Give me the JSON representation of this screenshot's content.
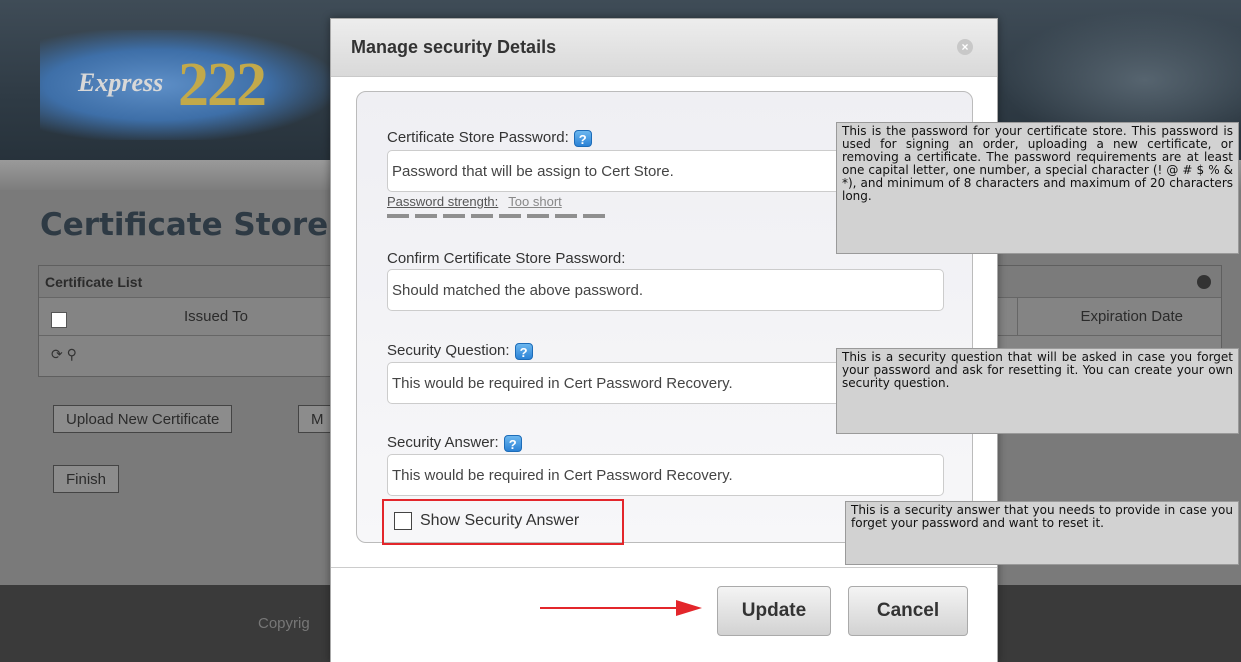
{
  "background": {
    "logo_text": "Express",
    "logo_number": "222",
    "page_title": "Certificate Store",
    "grid_caption": "Certificate List",
    "col_issued_to": "Issued To",
    "col_expiration": "Expiration Date",
    "toolbar_icons": "⟳ ⚲",
    "upload_button": "Upload New Certificate",
    "partial_button": "M",
    "finish_button": "Finish",
    "footer_text": "Copyrig"
  },
  "modal": {
    "title": "Manage security Details",
    "close_icon": "×",
    "cert_password_label": "Certificate Store Password:",
    "cert_password_placeholder": "Password that will be assign to Cert Store.",
    "strength_label": "Password strength:",
    "strength_value": "Too short",
    "confirm_label": "Confirm Certificate Store Password:",
    "confirm_placeholder": "Should matched the above password.",
    "question_label": "Security Question:",
    "question_placeholder": "This would be required in Cert Password Recovery.",
    "answer_label": "Security Answer:",
    "answer_placeholder": "This would be required in Cert Password Recovery.",
    "show_answer_label": "Show Security Answer",
    "update_button": "Update",
    "cancel_button": "Cancel",
    "help_glyph": "?"
  },
  "tooltips": {
    "password": "This is the password for your certificate store. This password is used for signing an order, uploading a new certificate, or removing a certificate. The password requirements are at least one capital letter, one number, a special character (! @ # $ % & *), and minimum of 8 characters and maximum of 20 characters long.",
    "question": "This is a security question that will be asked in case you forget your password and ask for resetting it. You can create your own security question.",
    "answer": "This is a security answer that you needs to provide in case you forget your password and want to reset it."
  },
  "colors": {
    "highlight_box": "#e3262b",
    "annotation_arrow": "#e3262b",
    "help_icon": "#2b82d6"
  }
}
